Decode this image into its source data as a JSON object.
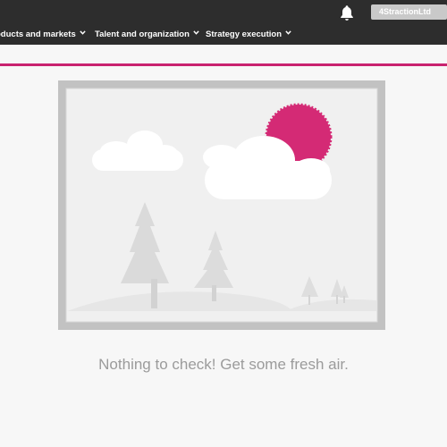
{
  "header": {
    "org_button_label": "4StractionLtd",
    "notifications_icon": "bell-icon"
  },
  "nav": {
    "items": [
      {
        "label": "oducts and markets",
        "icon": "chevron-down-icon"
      },
      {
        "label": "Talent and organization",
        "icon": "chevron-down-icon"
      },
      {
        "label": "Strategy execution",
        "icon": "chevron-down-icon"
      }
    ]
  },
  "colors": {
    "topbar": "#2d2d2d",
    "accent": "#c9226f",
    "sun": "#d42a75",
    "message_text": "#9b9b9b"
  },
  "empty_state": {
    "illustration": "landscape-picture-icon",
    "message": "Nothing to check! Get some fresh air."
  }
}
